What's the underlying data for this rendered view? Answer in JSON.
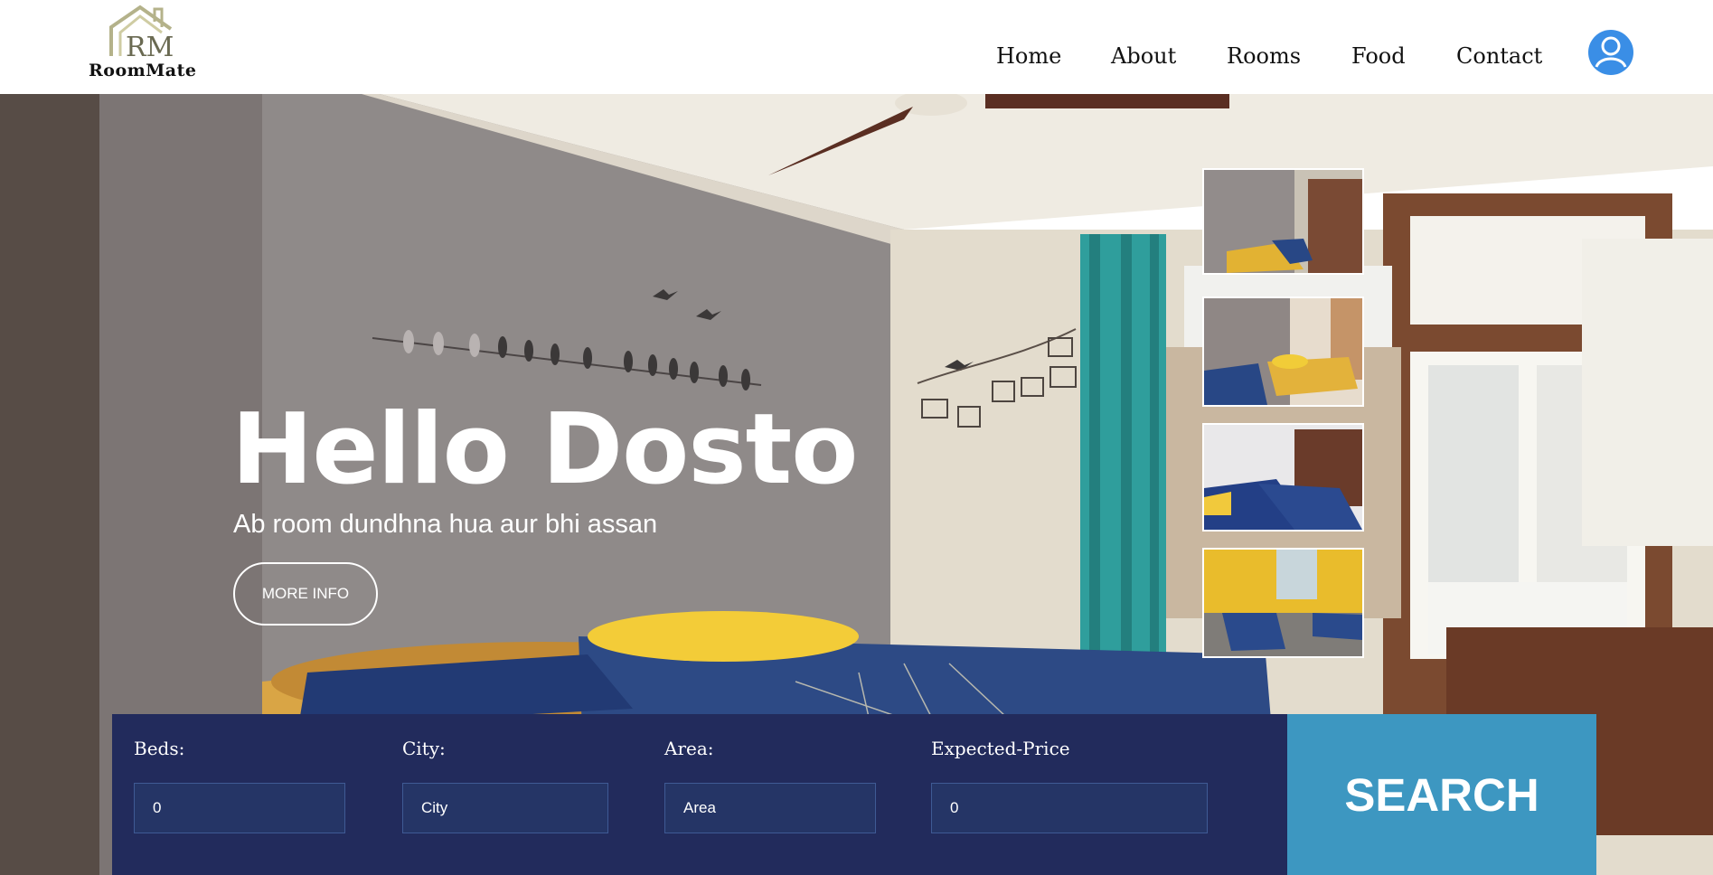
{
  "brand": {
    "name": "RoomMate",
    "monogram": "RM",
    "logo_icon": "house-icon"
  },
  "nav": [
    "Home",
    "About",
    "Rooms",
    "Food",
    "Contact"
  ],
  "profile": {
    "icon": "user-icon",
    "color": "#3a8ee6"
  },
  "hero": {
    "title": "Hello Dosto",
    "subtitle": "Ab room dundhna hua aur bhi assan",
    "button": "MORE INFO"
  },
  "search": {
    "fields": [
      {
        "label": "Beds:",
        "value": "0"
      },
      {
        "label": "City:",
        "placeholder": "City"
      },
      {
        "label": "Area:",
        "placeholder": "Area"
      },
      {
        "label": "Expected-Price",
        "value": "0"
      }
    ],
    "button": "SEARCH"
  },
  "colors": {
    "search_bg": "#222b5c",
    "search_button": "#3d97c1",
    "input_bg": "#253566"
  }
}
